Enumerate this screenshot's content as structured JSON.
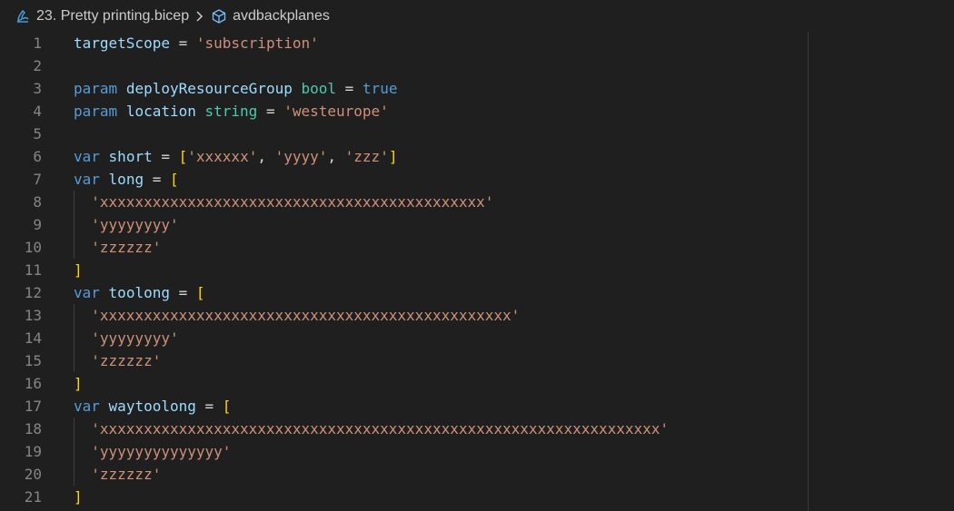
{
  "breadcrumb": {
    "file_name": "23. Pretty printing.bicep",
    "symbol_name": "avdbackplanes",
    "file_icon": "bicep-file-icon",
    "symbol_icon": "module-cube-icon",
    "separator": "chevron-right-icon"
  },
  "colors": {
    "background": "#1f1f1f",
    "keyword": "#569cd6",
    "identifier": "#9cdcfe",
    "type": "#4ec9b0",
    "string": "#ce9178",
    "bracket": "#ffd700",
    "line_number": "#858585"
  },
  "lines": [
    {
      "n": "1",
      "tokens": [
        [
          "id",
          "targetScope"
        ],
        [
          "op",
          " = "
        ],
        [
          "str",
          "'subscription'"
        ]
      ]
    },
    {
      "n": "2",
      "tokens": []
    },
    {
      "n": "3",
      "tokens": [
        [
          "kw",
          "param"
        ],
        [
          "pl",
          " "
        ],
        [
          "id",
          "deployResourceGroup"
        ],
        [
          "pl",
          " "
        ],
        [
          "ty",
          "bool"
        ],
        [
          "op",
          " = "
        ],
        [
          "kw",
          "true"
        ]
      ]
    },
    {
      "n": "4",
      "tokens": [
        [
          "kw",
          "param"
        ],
        [
          "pl",
          " "
        ],
        [
          "id",
          "location"
        ],
        [
          "pl",
          " "
        ],
        [
          "ty",
          "string"
        ],
        [
          "op",
          " = "
        ],
        [
          "str",
          "'westeurope'"
        ]
      ]
    },
    {
      "n": "5",
      "tokens": []
    },
    {
      "n": "6",
      "tokens": [
        [
          "kw",
          "var"
        ],
        [
          "pl",
          " "
        ],
        [
          "id",
          "short"
        ],
        [
          "op",
          " = "
        ],
        [
          "br",
          "["
        ],
        [
          "str",
          "'xxxxxx'"
        ],
        [
          "pl",
          ", "
        ],
        [
          "str",
          "'yyyy'"
        ],
        [
          "pl",
          ", "
        ],
        [
          "str",
          "'zzz'"
        ],
        [
          "br",
          "]"
        ]
      ]
    },
    {
      "n": "7",
      "tokens": [
        [
          "kw",
          "var"
        ],
        [
          "pl",
          " "
        ],
        [
          "id",
          "long"
        ],
        [
          "op",
          " = "
        ],
        [
          "br",
          "["
        ]
      ]
    },
    {
      "n": "8",
      "tokens": [
        [
          "pl",
          "  "
        ],
        [
          "str",
          "'xxxxxxxxxxxxxxxxxxxxxxxxxxxxxxxxxxxxxxxxxxxx'"
        ]
      ]
    },
    {
      "n": "9",
      "tokens": [
        [
          "pl",
          "  "
        ],
        [
          "str",
          "'yyyyyyyy'"
        ]
      ]
    },
    {
      "n": "10",
      "tokens": [
        [
          "pl",
          "  "
        ],
        [
          "str",
          "'zzzzzz'"
        ]
      ]
    },
    {
      "n": "11",
      "tokens": [
        [
          "br",
          "]"
        ]
      ]
    },
    {
      "n": "12",
      "tokens": [
        [
          "kw",
          "var"
        ],
        [
          "pl",
          " "
        ],
        [
          "id",
          "toolong"
        ],
        [
          "op",
          " = "
        ],
        [
          "br",
          "["
        ]
      ]
    },
    {
      "n": "13",
      "tokens": [
        [
          "pl",
          "  "
        ],
        [
          "str",
          "'xxxxxxxxxxxxxxxxxxxxxxxxxxxxxxxxxxxxxxxxxxxxxxx'"
        ]
      ]
    },
    {
      "n": "14",
      "tokens": [
        [
          "pl",
          "  "
        ],
        [
          "str",
          "'yyyyyyyy'"
        ]
      ]
    },
    {
      "n": "15",
      "tokens": [
        [
          "pl",
          "  "
        ],
        [
          "str",
          "'zzzzzz'"
        ]
      ]
    },
    {
      "n": "16",
      "tokens": [
        [
          "br",
          "]"
        ]
      ]
    },
    {
      "n": "17",
      "tokens": [
        [
          "kw",
          "var"
        ],
        [
          "pl",
          " "
        ],
        [
          "id",
          "waytoolong"
        ],
        [
          "op",
          " = "
        ],
        [
          "br",
          "["
        ]
      ]
    },
    {
      "n": "18",
      "tokens": [
        [
          "pl",
          "  "
        ],
        [
          "str",
          "'xxxxxxxxxxxxxxxxxxxxxxxxxxxxxxxxxxxxxxxxxxxxxxxxxxxxxxxxxxxxxxxx'"
        ]
      ]
    },
    {
      "n": "19",
      "tokens": [
        [
          "pl",
          "  "
        ],
        [
          "str",
          "'yyyyyyyyyyyyyy'"
        ]
      ]
    },
    {
      "n": "20",
      "tokens": [
        [
          "pl",
          "  "
        ],
        [
          "str",
          "'zzzzzz'"
        ]
      ]
    },
    {
      "n": "21",
      "tokens": [
        [
          "br",
          "]"
        ]
      ]
    }
  ]
}
